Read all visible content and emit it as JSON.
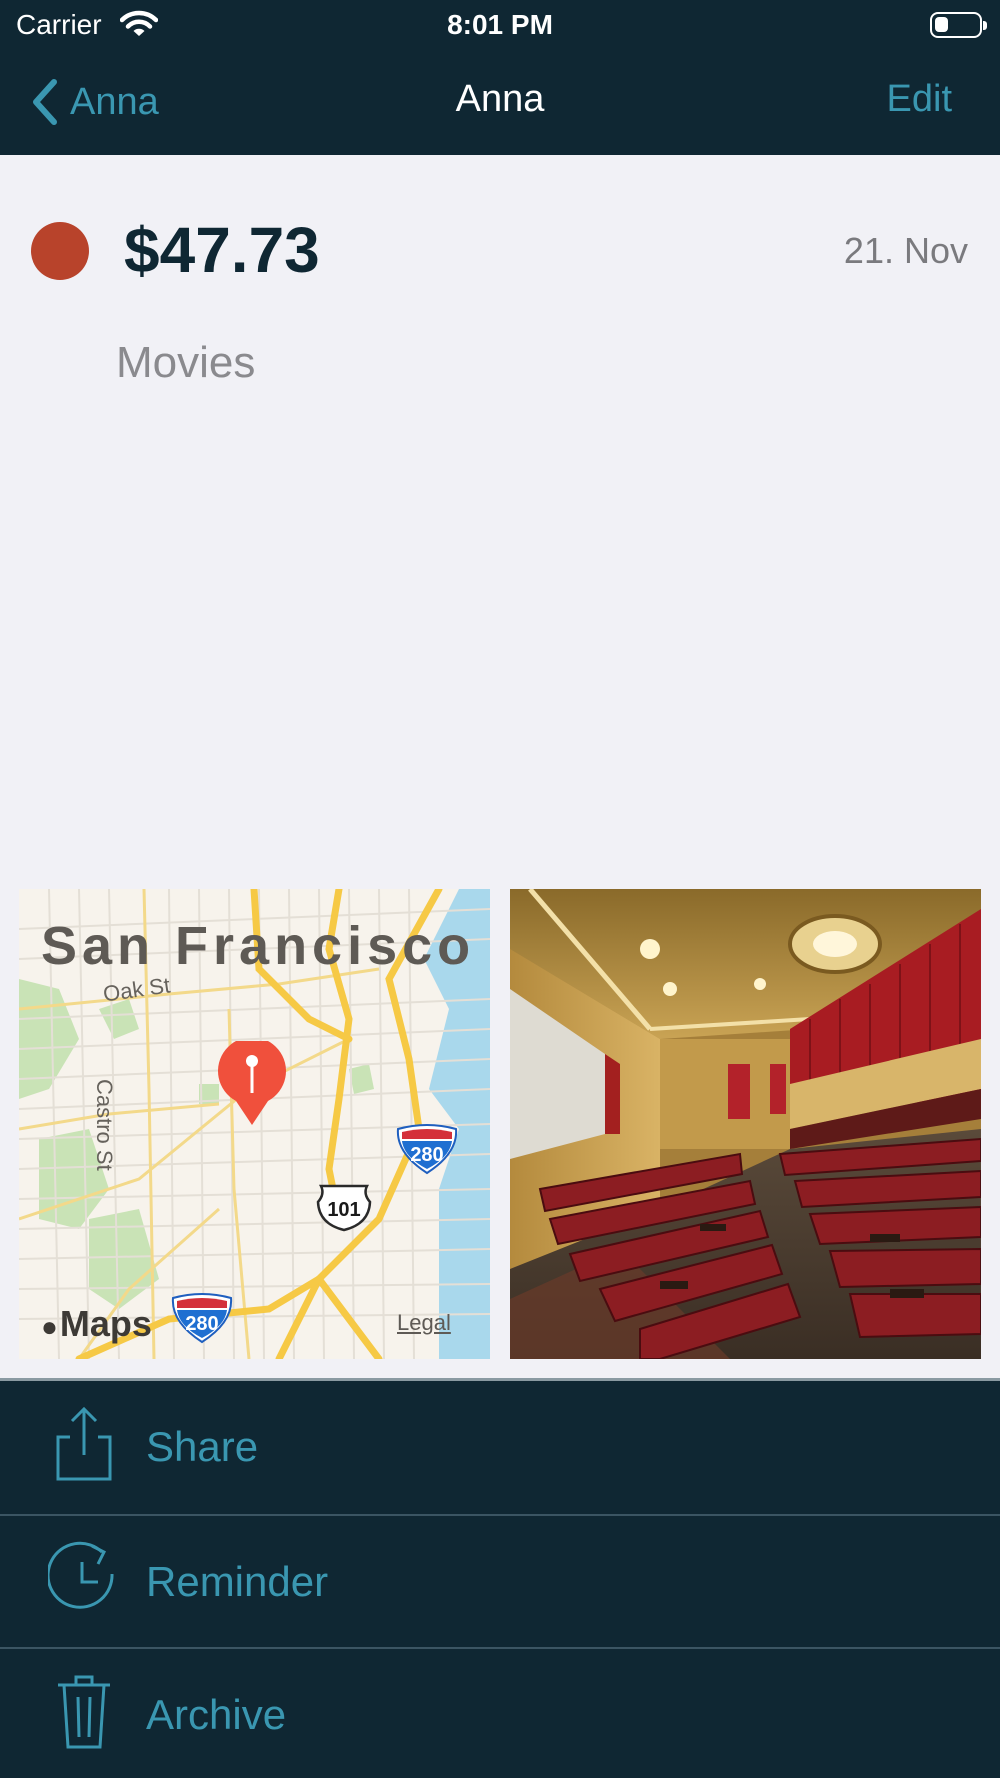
{
  "status_bar": {
    "carrier": "Carrier",
    "time": "8:01 PM",
    "battery_level": 0.3
  },
  "nav": {
    "back_label": "Anna",
    "title": "Anna",
    "edit_label": "Edit"
  },
  "entry": {
    "amount": "$47.73",
    "date": "21. Nov",
    "category": "Movies",
    "category_color": "#b8432b"
  },
  "map": {
    "city": "San Francisco",
    "street_1": "Oak St",
    "street_2": "Castro St",
    "shield_interstate_1": "280",
    "shield_interstate_2": "280",
    "shield_us": "101",
    "brand": "Maps",
    "legal": "Legal"
  },
  "actions": [
    {
      "label": "Share",
      "icon": "share-icon"
    },
    {
      "label": "Reminder",
      "icon": "reminder-icon"
    },
    {
      "label": "Archive",
      "icon": "trash-icon"
    }
  ],
  "colors": {
    "nav_background": "#0f2733",
    "accent": "#3a97b1",
    "page_background": "#f1f1f6"
  }
}
